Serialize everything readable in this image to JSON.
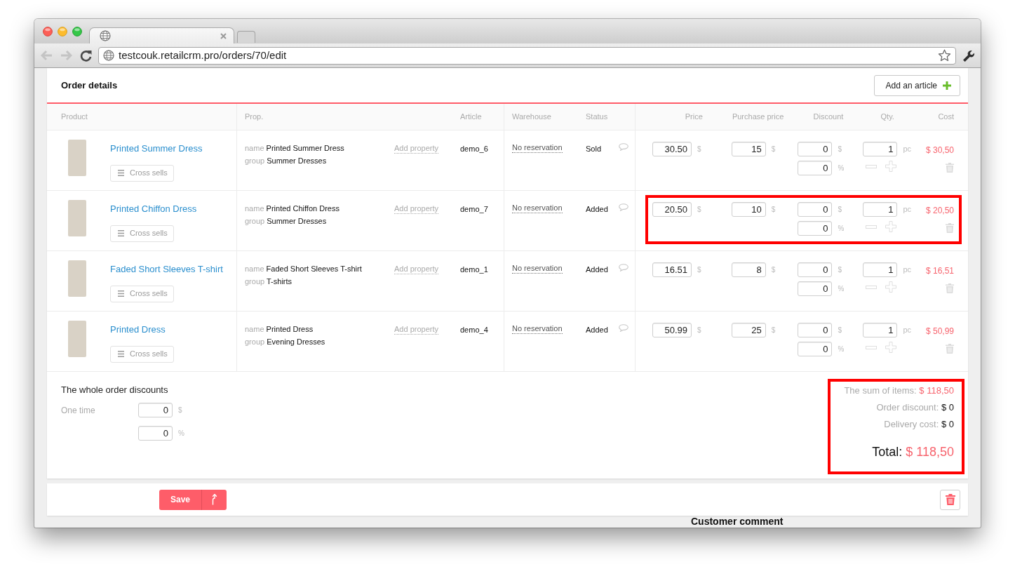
{
  "browser": {
    "url": "testcouk.retailcrm.pro/orders/70/edit",
    "back": {
      "disabled": true
    },
    "forward": {
      "disabled": true
    }
  },
  "card": {
    "title": "Order details",
    "add_button": "Add an article"
  },
  "table": {
    "columns": [
      "Product",
      "Prop.",
      "Article",
      "Warehouse",
      "Status",
      "Price",
      "Purchase price",
      "Discount",
      "Qty.",
      "Cost"
    ],
    "rows": [
      {
        "product": "Printed Summer Dress",
        "cross_sells": "Cross sells",
        "props": [
          {
            "key": "name",
            "value": "Printed Summer Dress"
          },
          {
            "key": "group",
            "value": "Summer Dresses"
          }
        ],
        "add_property": "Add property",
        "article": "demo_6",
        "warehouse": "No reservation",
        "status": "Sold",
        "price": {
          "value": "30.50",
          "unit": "$"
        },
        "purchase_price": {
          "value": "15",
          "unit": "$"
        },
        "discount_amount": {
          "value": "0",
          "unit": "$"
        },
        "discount_percent": {
          "value": "0",
          "unit": "%"
        },
        "qty": {
          "value": "1",
          "unit": "pc"
        },
        "cost": "$ 30,50",
        "highlighted": false
      },
      {
        "product": "Printed Chiffon Dress",
        "cross_sells": "Cross sells",
        "props": [
          {
            "key": "name",
            "value": "Printed Chiffon Dress"
          },
          {
            "key": "group",
            "value": "Summer Dresses"
          }
        ],
        "add_property": "Add property",
        "article": "demo_7",
        "warehouse": "No reservation",
        "status": "Added",
        "price": {
          "value": "20.50",
          "unit": "$"
        },
        "purchase_price": {
          "value": "10",
          "unit": "$"
        },
        "discount_amount": {
          "value": "0",
          "unit": "$"
        },
        "discount_percent": {
          "value": "0",
          "unit": "%"
        },
        "qty": {
          "value": "1",
          "unit": "pc"
        },
        "cost": "$ 20,50",
        "highlighted": true
      },
      {
        "product": "Faded Short Sleeves T-shirt",
        "cross_sells": "Cross sells",
        "props": [
          {
            "key": "name",
            "value": "Faded Short Sleeves T-shirt"
          },
          {
            "key": "group",
            "value": "T-shirts"
          }
        ],
        "add_property": "Add property",
        "article": "demo_1",
        "warehouse": "No reservation",
        "status": "Added",
        "price": {
          "value": "16.51",
          "unit": "$"
        },
        "purchase_price": {
          "value": "8",
          "unit": "$"
        },
        "discount_amount": {
          "value": "0",
          "unit": "$"
        },
        "discount_percent": {
          "value": "0",
          "unit": "%"
        },
        "qty": {
          "value": "1",
          "unit": "pc"
        },
        "cost": "$ 16,51",
        "highlighted": false
      },
      {
        "product": "Printed Dress",
        "cross_sells": "Cross sells",
        "props": [
          {
            "key": "name",
            "value": "Printed Dress"
          },
          {
            "key": "group",
            "value": "Evening Dresses"
          }
        ],
        "add_property": "Add property",
        "article": "demo_4",
        "warehouse": "No reservation",
        "status": "Added",
        "price": {
          "value": "50.99",
          "unit": "$"
        },
        "purchase_price": {
          "value": "25",
          "unit": "$"
        },
        "discount_amount": {
          "value": "0",
          "unit": "$"
        },
        "discount_percent": {
          "value": "0",
          "unit": "%"
        },
        "qty": {
          "value": "1",
          "unit": "pc"
        },
        "cost": "$ 50,99",
        "highlighted": false
      }
    ]
  },
  "order_discounts": {
    "title": "The whole order discounts",
    "label": "One time",
    "amount": {
      "value": "0",
      "unit": "$"
    },
    "percent": {
      "value": "0",
      "unit": "%"
    }
  },
  "totals": {
    "highlighted": true,
    "lines": [
      {
        "kind": "sum",
        "label": "The sum of items:",
        "value": "$ 118,50"
      },
      {
        "kind": "plain",
        "label": "Order discount:",
        "value": "$ 0"
      },
      {
        "kind": "plain",
        "label": "Delivery cost:",
        "value": "$ 0"
      },
      {
        "kind": "total",
        "label": "Total:",
        "value": "$ 118,50"
      }
    ]
  },
  "action_bar": {
    "save": "Save"
  },
  "below": {
    "heading": "Customer comment"
  }
}
